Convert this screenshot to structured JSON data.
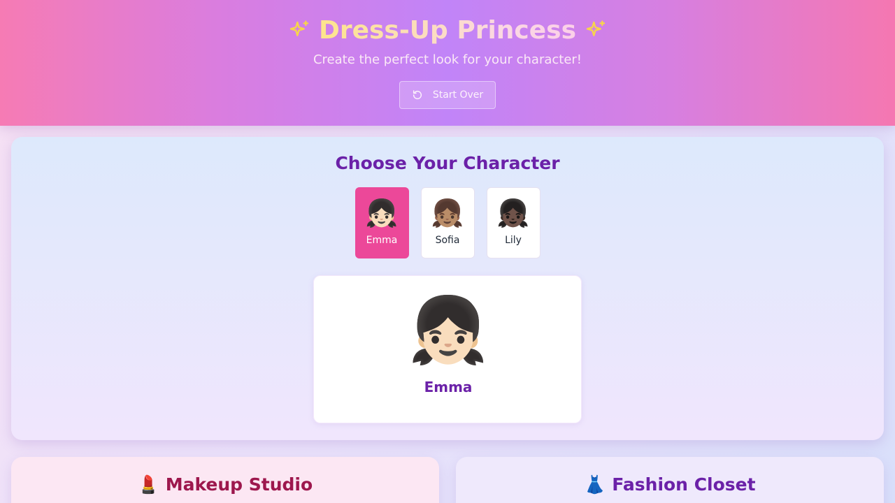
{
  "header": {
    "title": "Dress-Up Princess",
    "subtitle": "Create the perfect look for your character!",
    "start_over_label": "Start Over",
    "sparkle_icon": "sparkles-icon",
    "reset_icon": "rotate-ccw-icon"
  },
  "character_select": {
    "title": "Choose Your Character",
    "characters": [
      {
        "name": "Emma",
        "emoji": "👧🏻",
        "selected": true
      },
      {
        "name": "Sofia",
        "emoji": "👧🏽",
        "selected": false
      },
      {
        "name": "Lily",
        "emoji": "👧🏿",
        "selected": false
      }
    ],
    "preview": {
      "emoji": "👧🏻",
      "name": "Emma"
    }
  },
  "panels": {
    "makeup": {
      "icon": "💄",
      "title": "Makeup Studio"
    },
    "fashion": {
      "icon": "👗",
      "title": "Fashion Closet"
    }
  },
  "colors": {
    "accent_pink": "#ec4899",
    "purple_text": "#6b21a8",
    "makeup_text": "#9d174d"
  }
}
